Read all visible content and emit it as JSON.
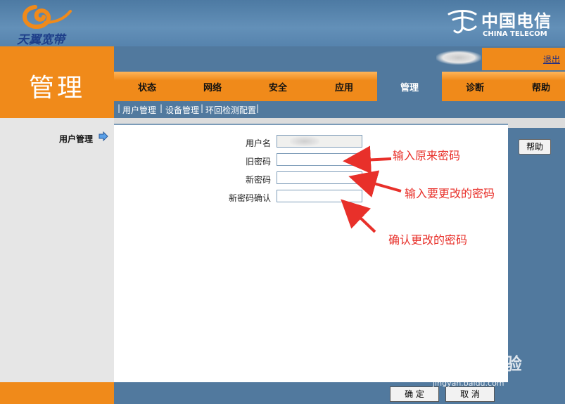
{
  "header": {
    "brand_left": "天翼宽带",
    "brand_cn": "中国电信",
    "brand_en": "CHINA TELECOM"
  },
  "section_title": "管理",
  "userbar": {
    "logout": "退出"
  },
  "nav": {
    "tabs": [
      {
        "label": "状态"
      },
      {
        "label": "网络"
      },
      {
        "label": "安全"
      },
      {
        "label": "应用"
      },
      {
        "label": "管理",
        "active": true
      },
      {
        "label": "诊断"
      },
      {
        "label": "帮助"
      }
    ]
  },
  "subnav": {
    "items": [
      {
        "label": "用户管理"
      },
      {
        "label": "设备管理"
      },
      {
        "label": "环回检测配置"
      }
    ],
    "separator": "|"
  },
  "left_nav": {
    "label": "用户管理"
  },
  "form": {
    "username_label": "用户名",
    "old_password_label": "旧密码",
    "new_password_label": "新密码",
    "confirm_password_label": "新密码确认",
    "old_password_value": "",
    "new_password_value": "",
    "confirm_password_value": ""
  },
  "help_button": "帮助",
  "annotations": {
    "note1": "输入原来密码",
    "note2": "输入要更改的密码",
    "note3": "确认更改的密码"
  },
  "footer": {
    "ok_button": "确 定",
    "cancel_button": "取 消"
  },
  "watermark": {
    "main": "Bai du 经验",
    "sub": "jingyan.baidu.com"
  },
  "colors": {
    "orange": "#f08a1a",
    "steel_blue": "#51799e",
    "annotation_red": "#e8302a"
  }
}
